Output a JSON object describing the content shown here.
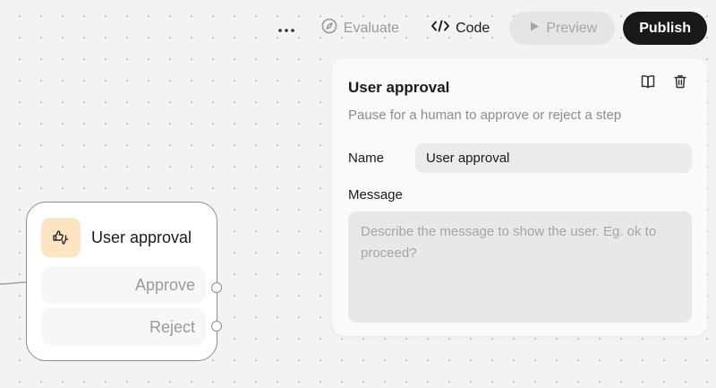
{
  "toolbar": {
    "more_icon": "more-horizontal-icon",
    "evaluate_label": "Evaluate",
    "evaluate_icon": "compass-icon",
    "code_label": "Code",
    "code_icon": "code-brackets-icon",
    "preview_label": "Preview",
    "preview_icon": "play-icon",
    "publish_label": "Publish"
  },
  "node": {
    "title": "User approval",
    "icon": "thumbs-up-down-icon",
    "branches": [
      {
        "label": "Approve"
      },
      {
        "label": "Reject"
      }
    ]
  },
  "panel": {
    "title": "User approval",
    "description": "Pause for a human to approve or reject a step",
    "actions": [
      {
        "icon": "docs-book-icon"
      },
      {
        "icon": "trash-icon"
      }
    ],
    "name_label": "Name",
    "name_value": "User approval",
    "message_label": "Message",
    "message_value": "",
    "message_placeholder": "Describe the message to show the user. Eg. ok to proceed?"
  },
  "colors": {
    "canvas_bg": "#f3f3f3",
    "canvas_dot": "#c4c4c4",
    "node_icon_bg": "#fde5c2",
    "publish_bg": "#191919",
    "preview_bg": "#e5e5e5",
    "panel_bg": "#fafafa",
    "input_bg": "#ebebeb"
  }
}
